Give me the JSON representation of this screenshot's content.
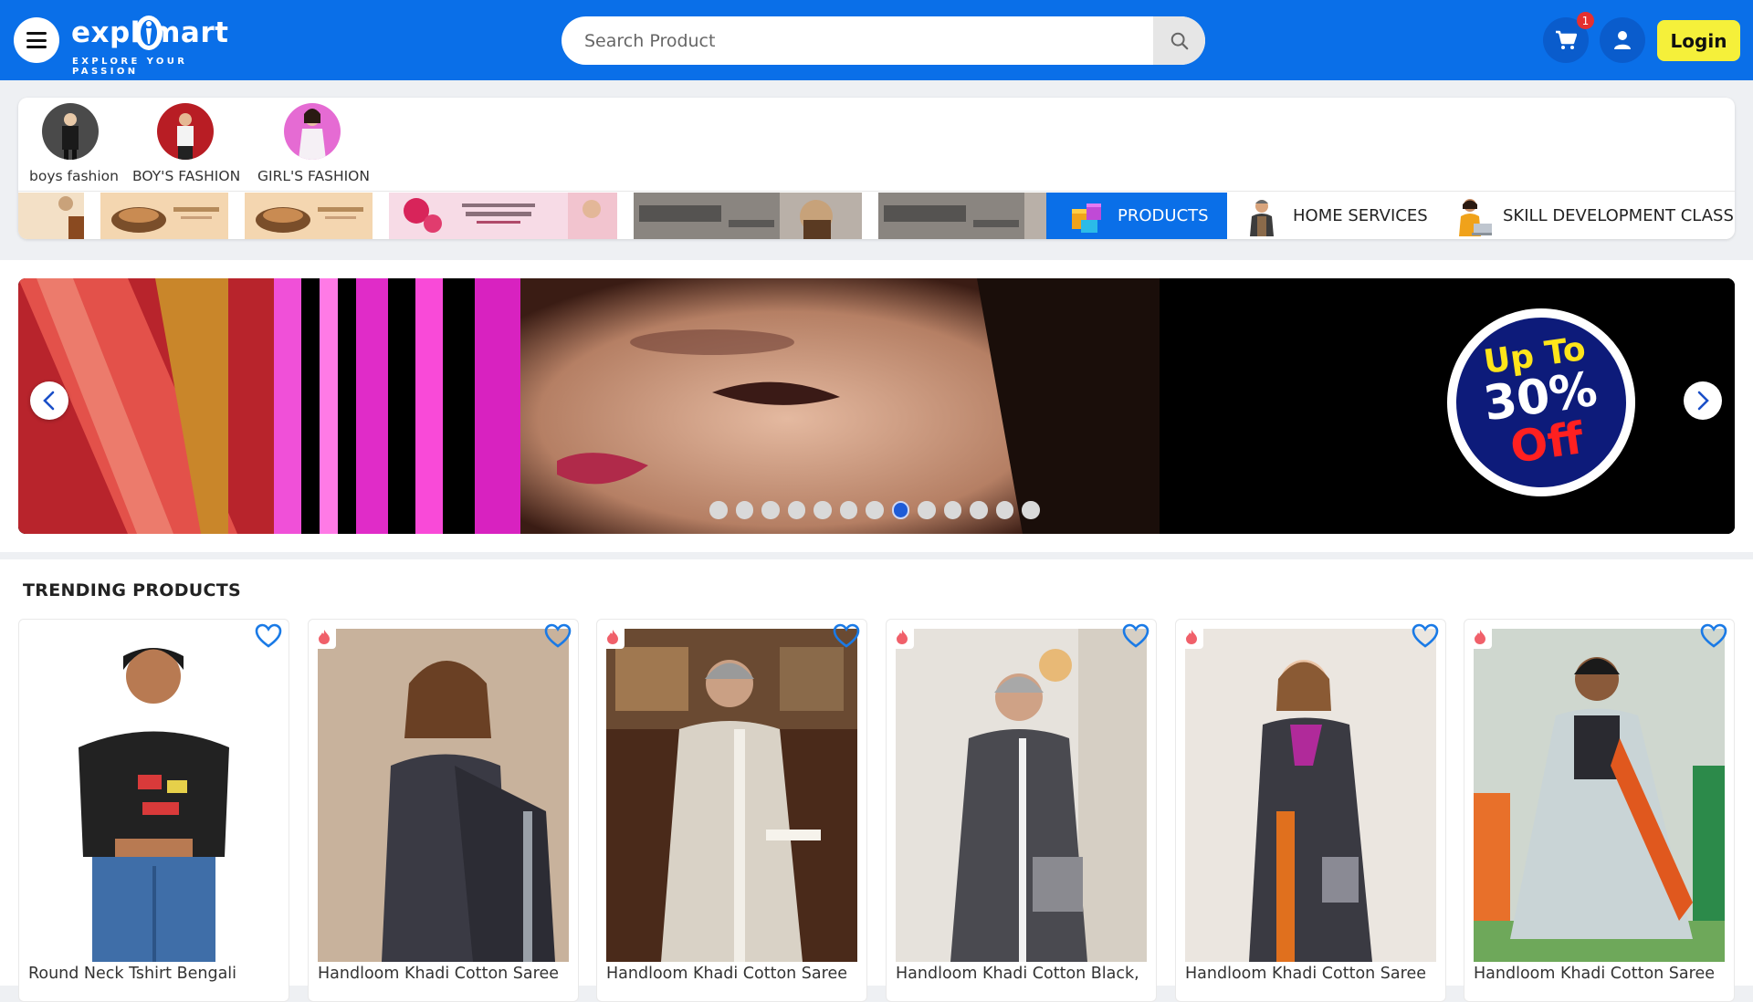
{
  "header": {
    "logo_word": "expl mart",
    "logo_tagline": "EXPLORE YOUR PASSION",
    "search_placeholder": "Search Product",
    "cart_count": "1",
    "login_label": "Login",
    "colors": {
      "header_bg": "#0a6fe8",
      "login_bg": "#f5f03a"
    }
  },
  "categories": [
    {
      "label": "boys fashion"
    },
    {
      "label": "BOY'S FASHION"
    },
    {
      "label": "GIRL'S FASHION"
    }
  ],
  "services": [
    {
      "label": "PRODUCTS",
      "icon": "box-icon",
      "active": true
    },
    {
      "label": "HOME SERVICES",
      "icon": "worker-icon"
    },
    {
      "label": "SKILL DEVELOPMENT CLASS",
      "icon": "student-icon"
    }
  ],
  "carousel": {
    "promo_line1": "Up To",
    "promo_line2": "30%",
    "promo_line3": "Off",
    "slide_count": 13,
    "active_slide": 8
  },
  "trending": {
    "title": "TRENDING PRODUCTS",
    "products": [
      {
        "name": "Round Neck Tshirt Bengali"
      },
      {
        "name": "Handloom Khadi Cotton Saree"
      },
      {
        "name": "Handloom Khadi Cotton Saree"
      },
      {
        "name": "Handloom Khadi Cotton Black,"
      },
      {
        "name": "Handloom Khadi Cotton Saree"
      },
      {
        "name": "Handloom Khadi Cotton Saree"
      }
    ]
  }
}
